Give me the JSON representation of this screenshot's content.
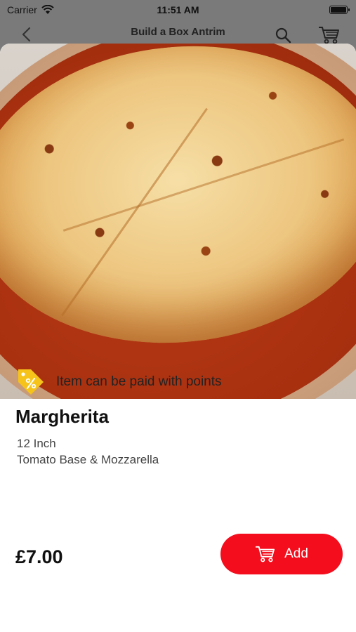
{
  "status_bar": {
    "carrier": "Carrier",
    "time": "11:51 AM",
    "wifi_icon": "wifi-icon",
    "battery_icon": "battery-icon"
  },
  "nav": {
    "title": "Build a Box Antrim",
    "back_icon": "chevron-left-icon",
    "search_icon": "search-icon",
    "cart_icon": "cart-icon"
  },
  "product": {
    "image": "pizza-photo",
    "points_icon": "discount-tag-icon",
    "points_text": "Item can be paid with points",
    "name": "Margherita",
    "size": "12 Inch",
    "toppings": "Tomato Base & Mozzarella",
    "price": "£7.00"
  },
  "add_button": {
    "label": "Add",
    "icon": "cart-icon"
  },
  "colors": {
    "accent": "#f40d1c",
    "tag_yellow": "#f6c31b",
    "overlay": "#7a7a7a"
  }
}
